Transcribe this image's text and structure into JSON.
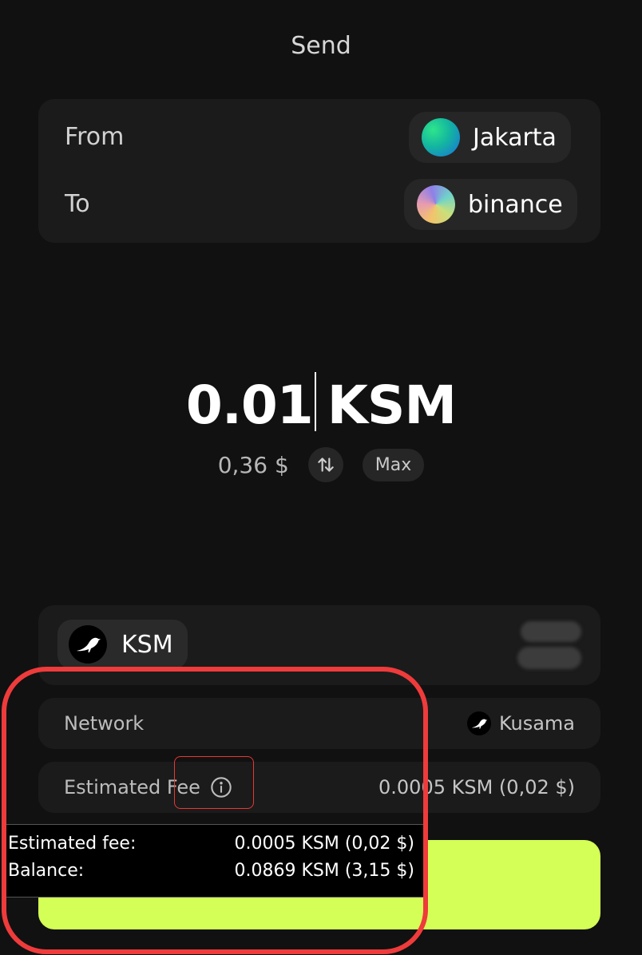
{
  "header": {
    "title": "Send"
  },
  "from": {
    "label": "From",
    "account": "Jakarta",
    "avatar_icon": "green-gradient-avatar"
  },
  "to": {
    "label": "To",
    "account": "binance",
    "avatar_icon": "multicolor-gradient-avatar"
  },
  "amount": {
    "value": "0.01",
    "unit": "KSM",
    "fiat": "0,36 $",
    "max_label": "Max"
  },
  "asset": {
    "name": "KSM",
    "icon": "kusama-bird-icon"
  },
  "network": {
    "label": "Network",
    "value": "Kusama",
    "icon": "kusama-bird-icon"
  },
  "fee": {
    "label": "Estimated Fee",
    "value": "0.0005 KSM (0,02 $)",
    "icon": "info-icon"
  },
  "tooltip": {
    "fee_label": "Estimated fee:",
    "fee_value": "0.0005 KSM (0,02 $)",
    "balance_label": "Balance:",
    "balance_value": "0.0869 KSM (3,15 $)"
  },
  "colors": {
    "background": "#111111",
    "card": "#1b1b1b",
    "accent_button": "#d4ff56",
    "annotation": "#ef3b3b"
  }
}
